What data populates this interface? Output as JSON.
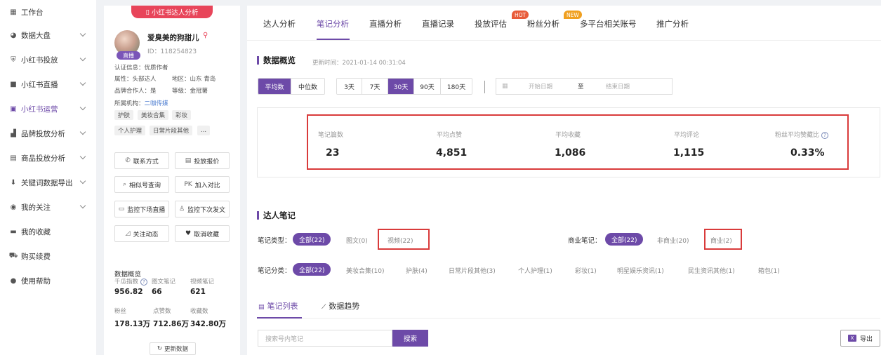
{
  "nav": {
    "items": [
      {
        "label": "工作台",
        "icon": "grid-icon",
        "chevron": false
      },
      {
        "label": "数据大盘",
        "icon": "pie-icon",
        "chevron": true
      },
      {
        "label": "小红书投放",
        "icon": "shield-icon",
        "chevron": true
      },
      {
        "label": "小红书直播",
        "icon": "video-icon",
        "chevron": true
      },
      {
        "label": "小红书运营",
        "icon": "chart-icon",
        "chevron": true,
        "active": true
      },
      {
        "label": "品牌投放分析",
        "icon": "bar-icon",
        "chevron": true
      },
      {
        "label": "商品投放分析",
        "icon": "box-icon",
        "chevron": true
      },
      {
        "label": "关键词数据导出",
        "icon": "download-icon",
        "chevron": true
      },
      {
        "label": "我的关注",
        "icon": "eye-icon",
        "chevron": true
      },
      {
        "label": "我的收藏",
        "icon": "folder-icon",
        "chevron": false
      },
      {
        "label": "购买续费",
        "icon": "cart-icon",
        "chevron": false
      },
      {
        "label": "使用帮助",
        "icon": "help-icon",
        "chevron": false
      }
    ]
  },
  "profile": {
    "ribbon": "小红书达人分析",
    "name": "爱臭美的狗甜儿",
    "live_badge": "直播",
    "id_text": "ID：118254823",
    "cert": "认证信息：优质作者",
    "attr": "属性：头部达人",
    "region": "地区：山东 青岛",
    "brand": "品牌合作人：是",
    "level": "等级：金冠薯",
    "org_label": "所属机构：",
    "org_link": "二咖传媒",
    "tags": [
      "护肤",
      "美妆合集",
      "彩妆",
      "个人护理",
      "日常片段其他",
      "..."
    ],
    "buttons": [
      {
        "label": "联系方式",
        "icon": "phone-icon"
      },
      {
        "label": "投放报价",
        "icon": "doc-icon"
      },
      {
        "label": "相似号查询",
        "icon": "search-icon"
      },
      {
        "label": "加入对比",
        "icon": "pk-icon",
        "prefix": "PK"
      },
      {
        "label": "监控下场直播",
        "icon": "monitor-icon"
      },
      {
        "label": "监控下次发文",
        "icon": "user-watch-icon"
      },
      {
        "label": "关注动态",
        "icon": "trend-icon"
      },
      {
        "label": "取消收藏",
        "icon": "heart-icon"
      }
    ],
    "stats_title": "数据概览",
    "stats": [
      {
        "label": "千瓜指数",
        "value": "956.82"
      },
      {
        "label": "图文笔记",
        "value": "66"
      },
      {
        "label": "视频笔记",
        "value": "621"
      },
      {
        "label": "粉丝",
        "value": "178.13万"
      },
      {
        "label": "点赞数",
        "value": "712.86万"
      },
      {
        "label": "收藏数",
        "value": "342.80万"
      }
    ],
    "refresh": "更新数据"
  },
  "tabs": [
    {
      "label": "达人分析"
    },
    {
      "label": "笔记分析",
      "active": true
    },
    {
      "label": "直播分析"
    },
    {
      "label": "直播记录"
    },
    {
      "label": "投放评估"
    },
    {
      "label": "粉丝分析",
      "badge": "HOT"
    },
    {
      "label": "多平台相关账号",
      "badge": "NEW"
    },
    {
      "label": "推广分析"
    }
  ],
  "overview": {
    "title": "数据概览",
    "update": "更新时间：2021-01-14 00:31:04",
    "mode": [
      "平均数",
      "中位数"
    ],
    "ranges": [
      "3天",
      "7天",
      "30天",
      "90天",
      "180天"
    ],
    "date_start": "开始日期",
    "date_to": "至",
    "date_end": "结束日期",
    "metrics": [
      {
        "label": "笔记篇数",
        "value": "23"
      },
      {
        "label": "平均点赞",
        "value": "4,851"
      },
      {
        "label": "平均收藏",
        "value": "1,086"
      },
      {
        "label": "平均评论",
        "value": "1,115"
      },
      {
        "label": "粉丝平均赞藏比",
        "value": "0.33%"
      }
    ]
  },
  "notes": {
    "title": "达人笔记",
    "type_label": "笔记类型：",
    "types": [
      "全部(22)",
      "图文(0)",
      "视频(22)"
    ],
    "biz_label": "商业笔记：",
    "biz": [
      "全部(22)",
      "非商业(20)",
      "商业(2)"
    ],
    "cat_label": "笔记分类：",
    "cats": [
      "全部(22)",
      "美妆合集(10)",
      "护肤(4)",
      "日常片段其他(3)",
      "个人护理(1)",
      "彩妆(1)",
      "明星娱乐资讯(1)",
      "民生资讯其他(1)",
      "箱包(1)"
    ],
    "subtabs": [
      "笔记列表",
      "数据趋势"
    ],
    "search_placeholder": "搜索号内笔记",
    "search_btn": "搜索",
    "export_btn": "导出"
  },
  "colors": {
    "accent": "#6d4aa8",
    "highlight": "#d93b3b",
    "hot": "#e85c3a",
    "new": "#f0a020"
  }
}
